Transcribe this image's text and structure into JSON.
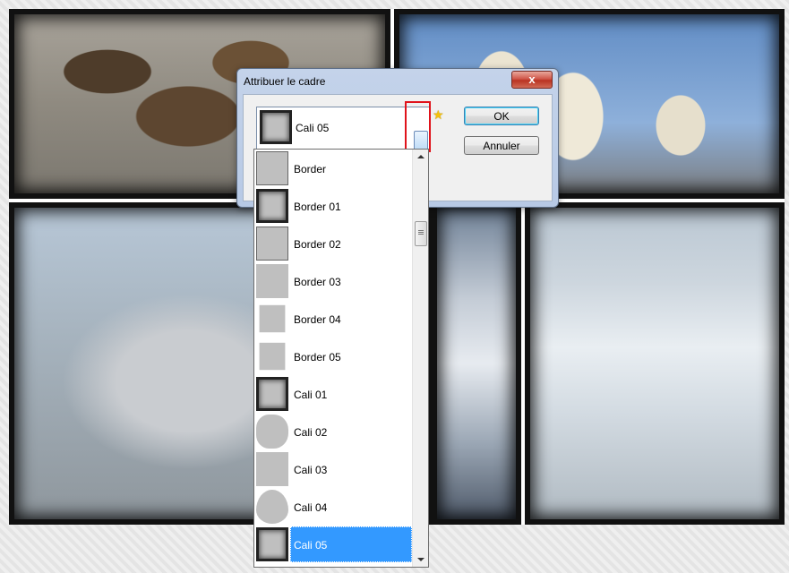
{
  "dialog": {
    "title": "Attribuer le cadre",
    "close_label": "x",
    "combo_value": "Cali 05",
    "ok_label": "OK",
    "cancel_label": "Annuler"
  },
  "frames": [
    {
      "label": "Border",
      "style": "line"
    },
    {
      "label": "Border 01",
      "style": "dark"
    },
    {
      "label": "Border 02",
      "style": "line"
    },
    {
      "label": "Border 03",
      "style": "plain"
    },
    {
      "label": "Border 04",
      "style": "small"
    },
    {
      "label": "Border 05",
      "style": "small"
    },
    {
      "label": "Cali 01",
      "style": "dark"
    },
    {
      "label": "Cali 02",
      "style": "round"
    },
    {
      "label": "Cali 03",
      "style": "plain"
    },
    {
      "label": "Cali 04",
      "style": "heart"
    },
    {
      "label": "Cali 05",
      "style": "dark",
      "selected": true
    }
  ],
  "colors": {
    "selection": "#3399ff",
    "highlight_box": "#e0131b",
    "close_button": "#c8483a"
  },
  "icons": {
    "close": "close-icon",
    "dropdown": "chevron-down-icon",
    "favorite": "star-icon",
    "scroll_grip": "scroll-grip-icon"
  }
}
